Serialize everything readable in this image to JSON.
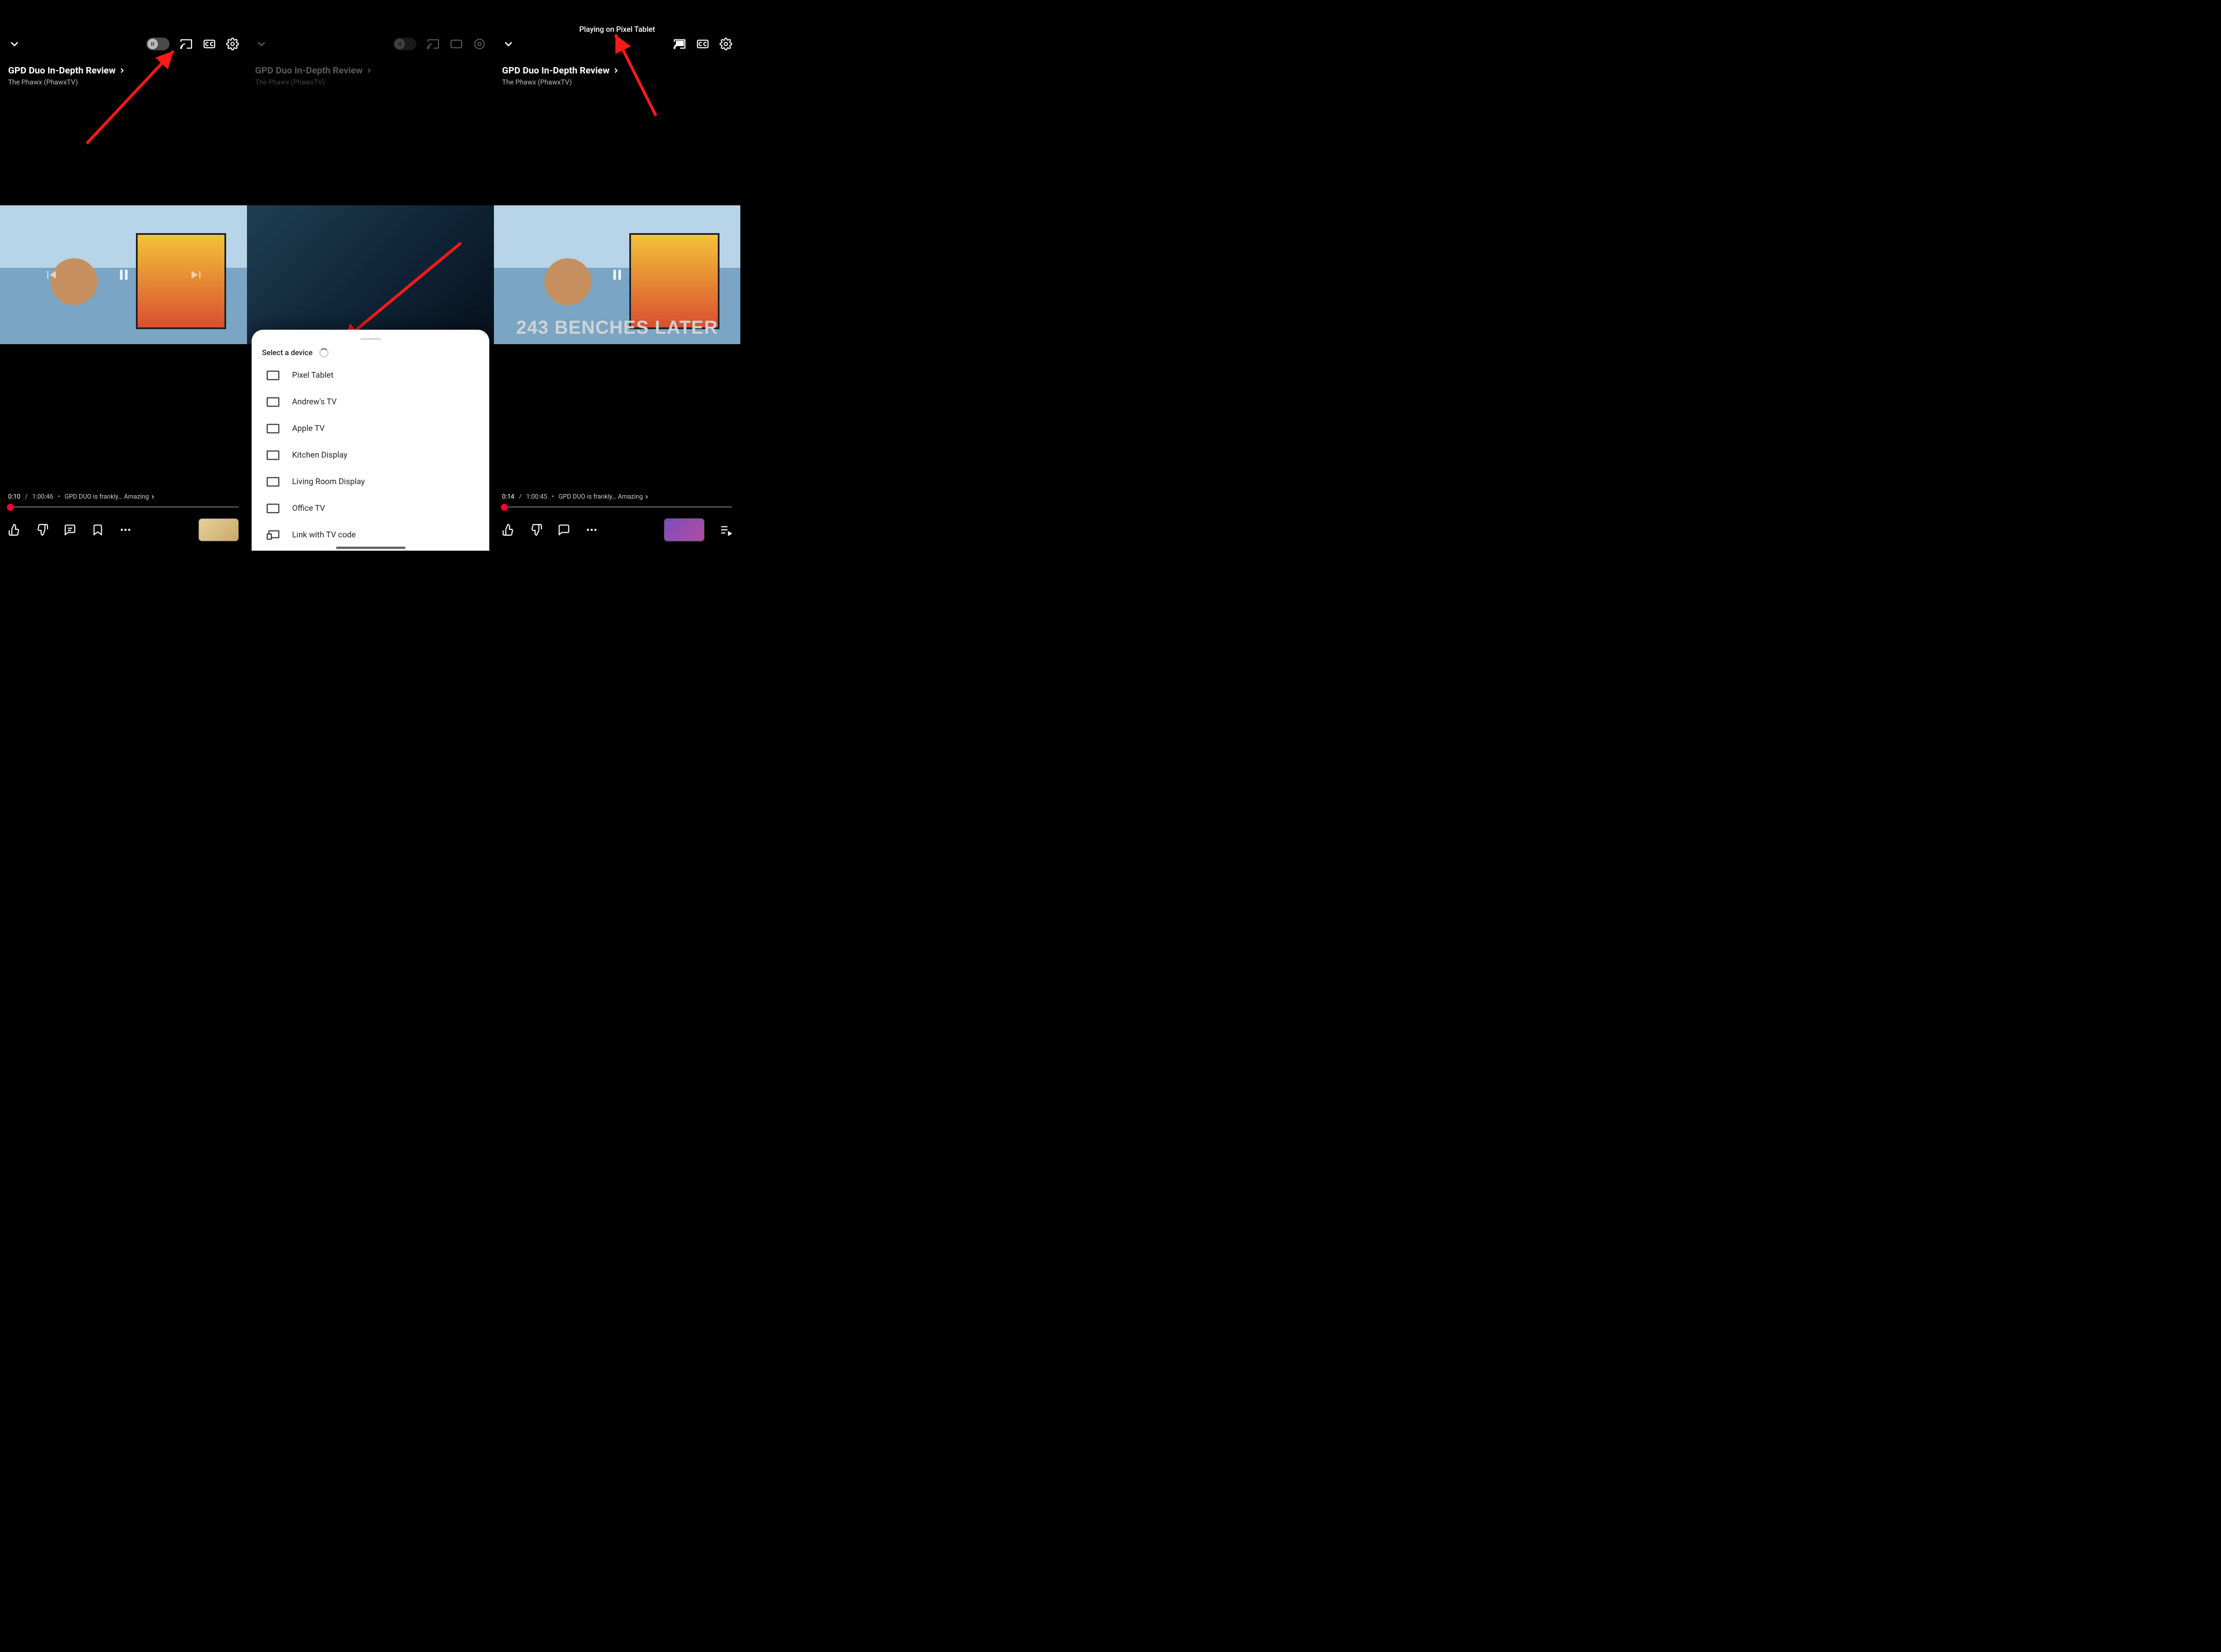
{
  "video": {
    "title": "GPD Duo In-Depth Review",
    "channel": "The Phawx (PhawxTV)"
  },
  "panel1": {
    "time_current": "0:10",
    "time_total": "1:00:46",
    "chapter": "GPD DUO is frankly… Amazing"
  },
  "panel2": {
    "sheet_title": "Select a device",
    "devices": [
      "Pixel Tablet",
      "Andrew's TV",
      "Apple TV",
      "Kitchen Display",
      "Living Room Display",
      "Office TV"
    ],
    "link_tv": "Link with TV code"
  },
  "panel3": {
    "status": "Playing on Pixel Tablet",
    "overlay": "243 BENCHES LATER",
    "time_current": "0:14",
    "time_total": "1:00:45",
    "chapter": "GPD DUO is frankly… Amazing"
  }
}
